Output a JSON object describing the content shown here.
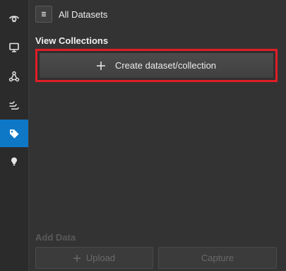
{
  "sidebar": {
    "items": [
      {
        "icon": "eye-icon",
        "active": false
      },
      {
        "icon": "monitor-icon",
        "active": false
      },
      {
        "icon": "network-icon",
        "active": false
      },
      {
        "icon": "signal-icon",
        "active": false
      },
      {
        "icon": "tag-icon",
        "active": true
      },
      {
        "icon": "lightbulb-icon",
        "active": false
      }
    ]
  },
  "header": {
    "menu_icon": "menu-icon",
    "title": "All Datasets"
  },
  "collections": {
    "title": "View Collections",
    "create_label": "Create dataset/collection",
    "create_icon": "plus-icon"
  },
  "add_data": {
    "title": "Add Data",
    "upload_label": "Upload",
    "upload_icon": "plus-icon",
    "capture_label": "Capture"
  },
  "colors": {
    "accent": "#0e78c7",
    "highlight": "#e01e26",
    "background": "#333333"
  }
}
